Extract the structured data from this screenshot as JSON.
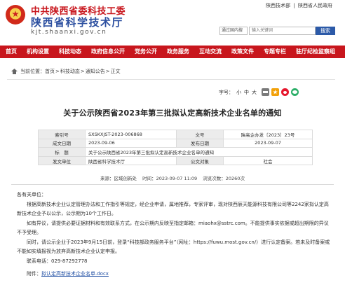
{
  "header": {
    "org_name": "中共陕西省委科技工委",
    "org_name_2": "陕西省科学技术厅",
    "domain": "kjt.shaanxi.gov.cn",
    "top_links": [
      "陕西技术部",
      "|",
      "陕西省人民政府"
    ],
    "scope_select": "通过国内搜",
    "search_placeholder": "输入关键词",
    "search_button": "搜索"
  },
  "nav": {
    "items": [
      "首页",
      "机构设置",
      "科技动态",
      "政府信息公开",
      "党务公开",
      "政务服务",
      "互动交流",
      "政策文件",
      "专题专栏",
      "驻厅纪检监察组"
    ]
  },
  "breadcrumb": {
    "prefix": "当前位置：",
    "items": [
      "首页",
      "科技动态",
      "通知公告",
      "正文"
    ],
    "sep": ">"
  },
  "tools": {
    "font_label": "字号：",
    "small": "小",
    "medium": "中",
    "large": "大"
  },
  "article": {
    "title": "关于公示陕西省2023年第三批拟认定高新技术企业名单的通知",
    "meta": {
      "index_label": "索引号",
      "index_value": "SXSKXJST-2023-006868",
      "doc_no_label": "文号",
      "doc_no_value": "陕高企办发〔2023〕23号",
      "date_label": "成文日期",
      "date_value": "2023-09-06",
      "pub_date_label": "发布日期",
      "pub_date_value": "2023-09-07",
      "subject_label": "标　题",
      "subject_value": "关于公示陕西省2023年第三批拟认定高新技术企业名单的通知",
      "issuer_label": "发文单位",
      "issuer_value": "陕西省科学技术厅",
      "open_label": "公文对象",
      "open_value": "社会"
    },
    "pub_info": {
      "source": "来源：区域创新处",
      "time": "时间：2023-09-07 11:09",
      "views": "浏览次数：20260次"
    },
    "greeting": "各有关单位：",
    "paragraphs": [
      "根据高新技术企业认定管理办法和工作指引等规定，经企业申请，属地推荐，专家评审，现对陕西辰天能源科技有限公司等2242家拟认定高新技术企业予以公示，公示期为10个工作日。",
      "如有异议，请提供必要证据材料和有效联系方式，在公示期内反映至指定邮箱：miaohx@sstrc.com。不能提供事实依据或超出期限的异议不予受理。",
      "同时，请公示企业于2023年9月15日前，登录“科技部政务服务平台”（网址：https://fuwu.most.gov.cn/）进行认定备案。若未及时备案或不能如实填报视为放弃高新技术企业认定申报。"
    ],
    "contact": "联系电话：029-87292778",
    "attachment_label": "附件：",
    "attachment_name": "拟认定高新技术企业名单.docx"
  }
}
